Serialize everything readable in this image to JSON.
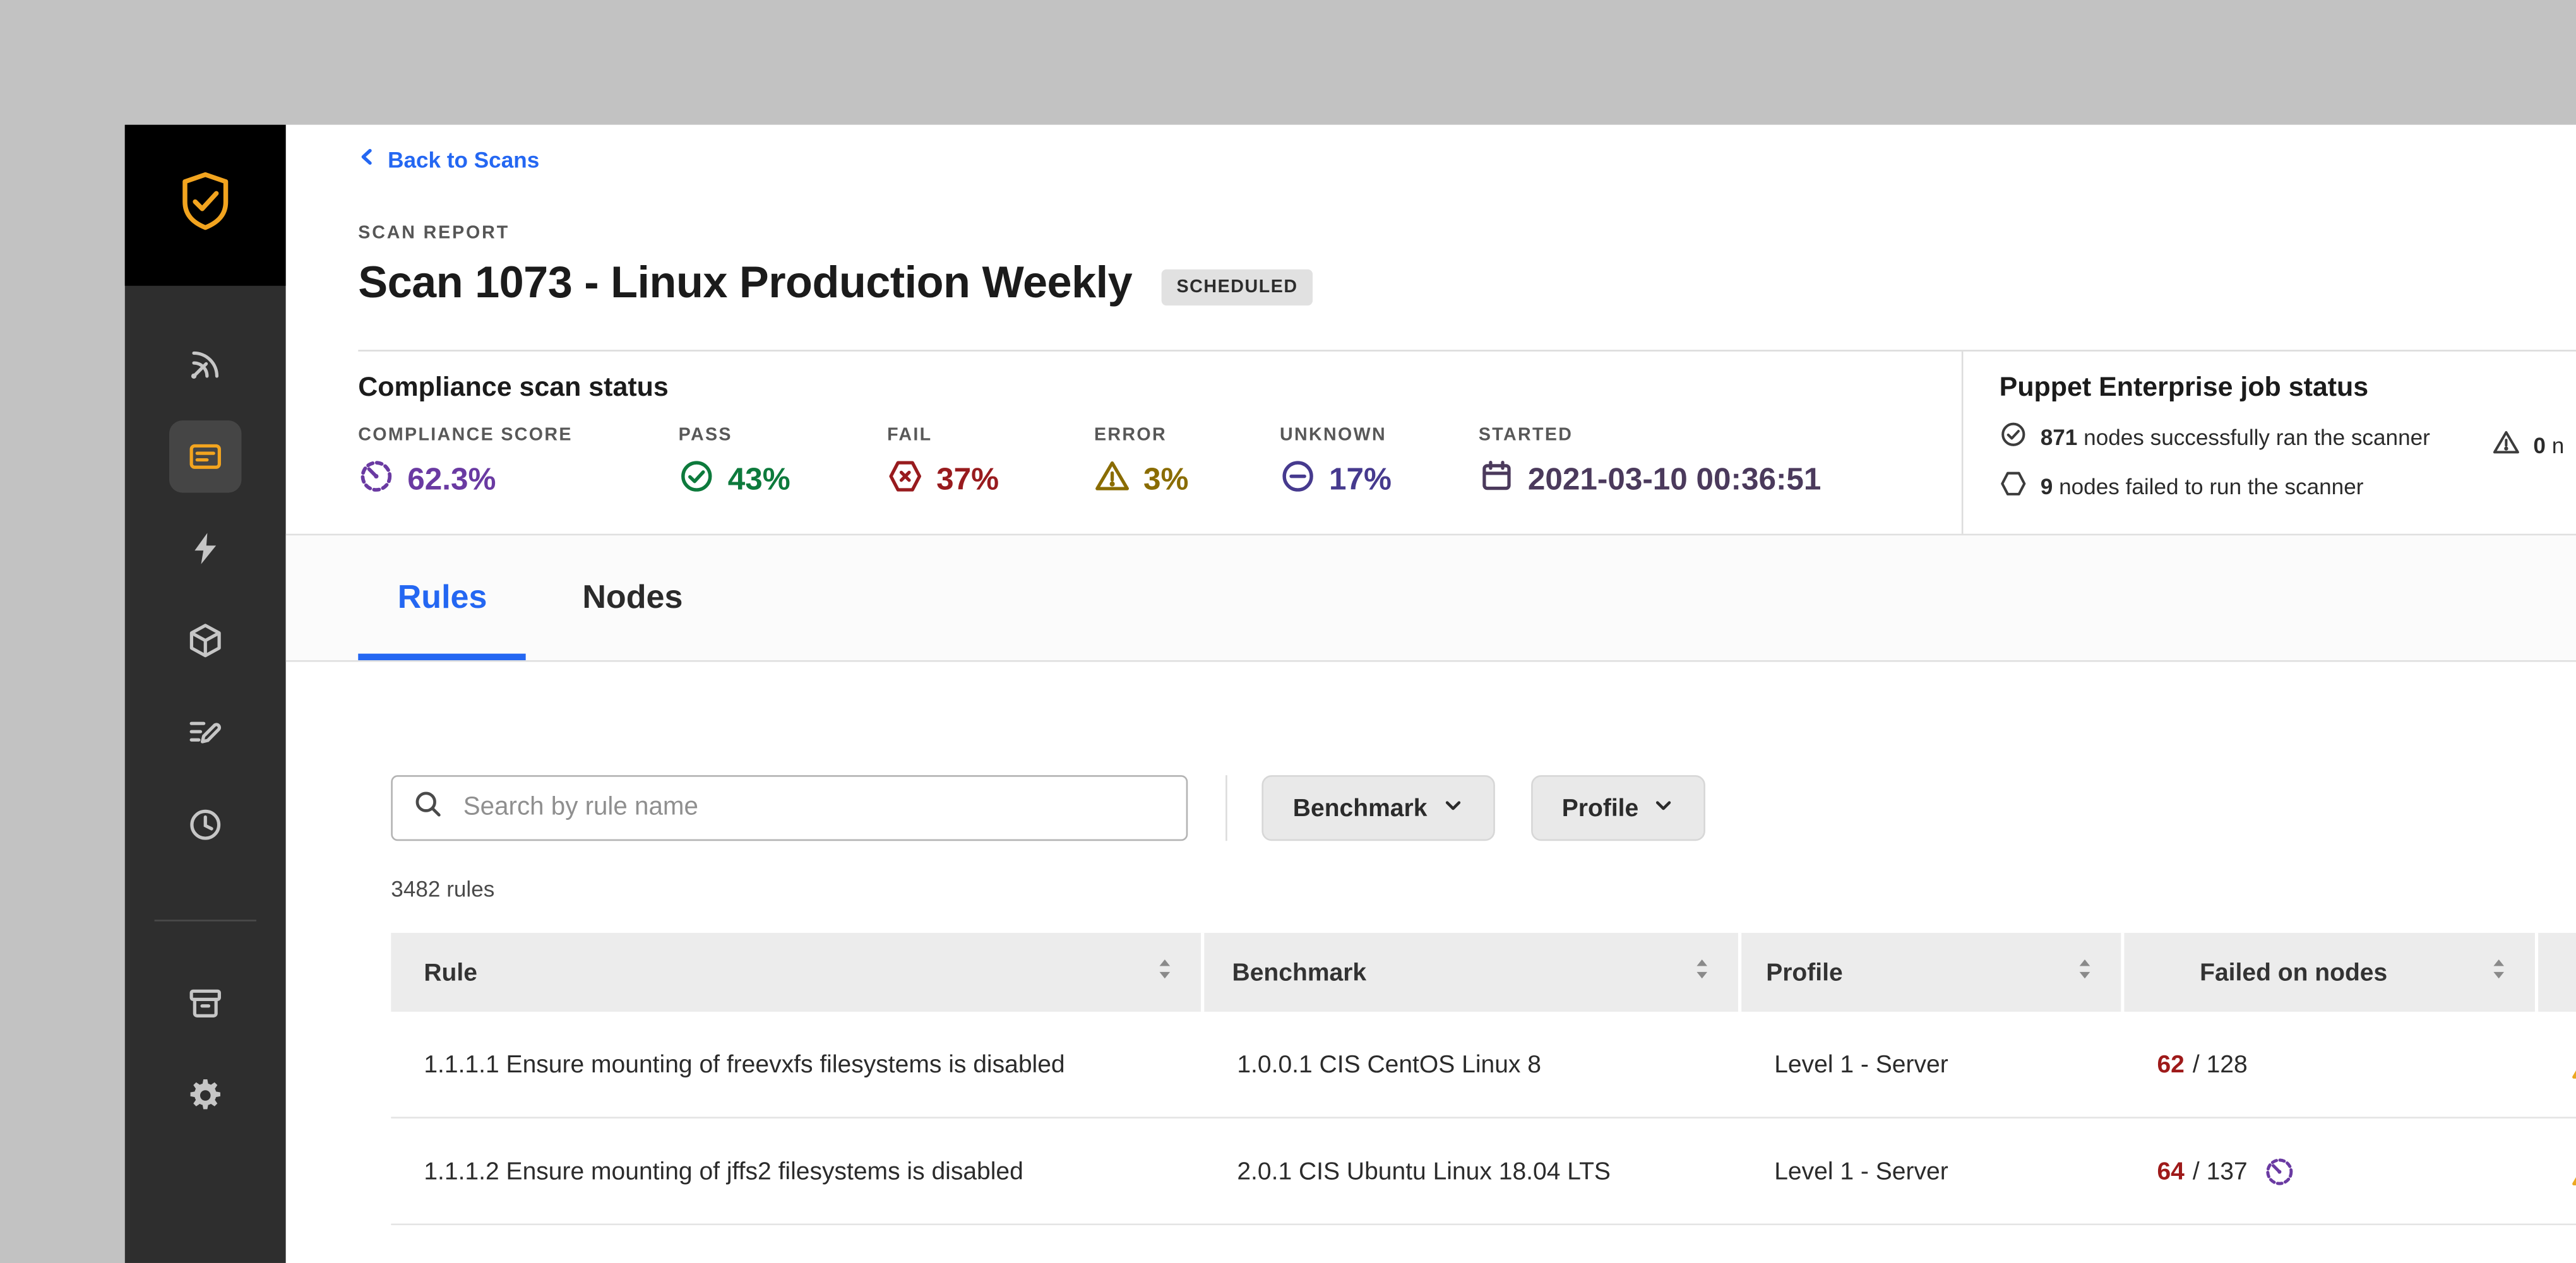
{
  "colors": {
    "accent_blue": "#2467f2",
    "amber": "#f2a41f",
    "sidebar_bg": "#2e2e2e",
    "logo_bg": "#000000",
    "failed_red": "#9e1a1a"
  },
  "header": {
    "back_link": "Back to Scans",
    "eyebrow": "SCAN REPORT",
    "title": "Scan 1073 - Linux Production Weekly",
    "badge": "SCHEDULED"
  },
  "sidebar": {
    "items": [
      {
        "icon": "radar-icon",
        "active": false
      },
      {
        "icon": "scan-icon",
        "active": true
      },
      {
        "icon": "lightning-icon",
        "active": false
      },
      {
        "icon": "package-icon",
        "active": false
      },
      {
        "icon": "edit-list-icon",
        "active": false
      },
      {
        "icon": "history-icon",
        "active": false
      }
    ],
    "footer_items": [
      {
        "icon": "archive-icon"
      },
      {
        "icon": "settings-gear-icon"
      }
    ]
  },
  "status": {
    "title": "Compliance scan status",
    "metrics": [
      {
        "label": "COMPLIANCE SCORE",
        "value": "62.3%",
        "icon": "gauge-icon",
        "color": "#6a3aa2"
      },
      {
        "label": "PASS",
        "value": "43%",
        "icon": "check-circle-icon",
        "color": "#0d7a3c"
      },
      {
        "label": "FAIL",
        "value": "37%",
        "icon": "hexagon-fail-icon",
        "color": "#981b1e"
      },
      {
        "label": "ERROR",
        "value": "3%",
        "icon": "warning-triangle-icon",
        "color": "#8a6c00"
      },
      {
        "label": "UNKNOWN",
        "value": "17%",
        "icon": "circle-minus-icon",
        "color": "#463a8e"
      },
      {
        "label": "STARTED",
        "value": "2021-03-10 00:36:51",
        "icon": "calendar-icon",
        "color": "#4b3a5c"
      }
    ]
  },
  "pe_job": {
    "title": "Puppet Enterprise job status",
    "lines": [
      {
        "count": "871",
        "text": "nodes successfully ran the scanner",
        "icon": "check-circle-icon"
      },
      {
        "count": "9",
        "text": "nodes failed to run the scanner",
        "icon": "hexagon-icon"
      }
    ],
    "truncated_line": {
      "count": "0",
      "text": "n",
      "icon": "warning-triangle-icon"
    }
  },
  "tabs": [
    {
      "label": "Rules",
      "active": true
    },
    {
      "label": "Nodes",
      "active": false
    }
  ],
  "toolbar": {
    "search_placeholder": "Search by rule name",
    "filters": [
      {
        "label": "Benchmark",
        "icon": "chevron-down-icon"
      },
      {
        "label": "Profile",
        "icon": "chevron-down-icon"
      }
    ]
  },
  "rules_summary": "3482 rules",
  "table": {
    "columns": [
      {
        "label": "Rule",
        "icon": "sort-icon"
      },
      {
        "label": "Benchmark",
        "icon": "sort-icon"
      },
      {
        "label": "Profile",
        "icon": "sort-icon"
      },
      {
        "label": "Failed on nodes",
        "icon": "sort-icon"
      }
    ],
    "rows": [
      {
        "rule": "1.1.1.1 Ensure mounting of freevxfs filesystems is disabled",
        "benchmark": "1.0.0.1 CIS CentOS Linux 8",
        "profile": "Level 1 - Server",
        "failed": "62",
        "of_total": "/ 128"
      },
      {
        "rule": "1.1.1.2 Ensure mounting of jffs2 filesystems is disabled",
        "benchmark": "2.0.1 CIS Ubuntu Linux 18.04 LTS",
        "profile": "Level 1 - Server",
        "failed": "64",
        "of_total": "/ 137",
        "gauge_icon": "gauge-icon"
      }
    ]
  }
}
